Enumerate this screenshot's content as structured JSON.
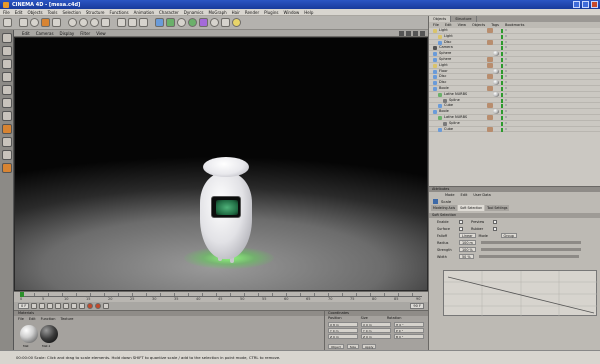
{
  "window": {
    "title": "CINEMA 4D - [mesa.c4d]"
  },
  "menu": [
    "File",
    "Edit",
    "Objects",
    "Tools",
    "Selection",
    "Structure",
    "Functions",
    "Animation",
    "Character",
    "Dynamics",
    "MoGraph",
    "Hair",
    "Render",
    "Plugins",
    "Window",
    "Help"
  ],
  "viewport": {
    "menu": [
      "Edit",
      "Cameras",
      "Display",
      "Filter",
      "View"
    ]
  },
  "timeline": {
    "ticks": [
      "0",
      "5",
      "10",
      "15",
      "20",
      "25",
      "30",
      "35",
      "40",
      "45",
      "50",
      "55",
      "60",
      "65",
      "70",
      "75",
      "80",
      "85",
      "90"
    ],
    "current_frame": "0 F",
    "end_frame": "90 F"
  },
  "materials": {
    "title": "Materials",
    "menu": [
      "File",
      "Edit",
      "Function",
      "Texture"
    ],
    "items": [
      "Mat",
      "Mat.1"
    ]
  },
  "coordinates": {
    "title": "Coordinates",
    "columns": [
      "Position",
      "Size",
      "Rotation"
    ],
    "rows": [
      [
        "X  8 m",
        "X  0 m",
        "H  0 °"
      ],
      [
        "Y  0 m",
        "Y  0 m",
        "P  0 °"
      ],
      [
        "Z  0 m",
        "Z  0 m",
        "B  0 °"
      ]
    ],
    "apply": [
      "Object",
      "Size",
      "Apply"
    ]
  },
  "object_manager": {
    "tabs": [
      "Objects",
      "Structure"
    ],
    "menu": [
      "File",
      "Edit",
      "View",
      "Objects",
      "Tags",
      "Bookmarks"
    ],
    "objects": [
      {
        "name": "Light",
        "color": "#d9c36a",
        "indent": 0,
        "tag": "checker"
      },
      {
        "name": "Light",
        "color": "#d9c36a",
        "indent": 1,
        "tag": ""
      },
      {
        "name": "Disc",
        "color": "#6a9bd9",
        "indent": 1,
        "tag": "checker"
      },
      {
        "name": "Camera",
        "color": "#555555",
        "indent": 0,
        "tag": ""
      },
      {
        "name": "Sphere",
        "color": "#6a9bd9",
        "indent": 0,
        "tag": "ball"
      },
      {
        "name": "Sphere",
        "color": "#6a9bd9",
        "indent": 0,
        "tag": "checker"
      },
      {
        "name": "Light",
        "color": "#d9c36a",
        "indent": 0,
        "tag": "checker"
      },
      {
        "name": "Floor",
        "color": "#6a9bd9",
        "indent": 0,
        "tag": "ball"
      },
      {
        "name": "Disc",
        "color": "#6a9bd9",
        "indent": 0,
        "tag": "checker"
      },
      {
        "name": "Disc",
        "color": "#6a9bd9",
        "indent": 0,
        "tag": "ball"
      },
      {
        "name": "Boole",
        "color": "#6a9bd9",
        "indent": 0,
        "tag": "checker"
      },
      {
        "name": "Lathe NURBS",
        "color": "#6ab06a",
        "indent": 1,
        "tag": "ball"
      },
      {
        "name": "Spline",
        "color": "#7a7a7a",
        "indent": 2,
        "tag": ""
      },
      {
        "name": "Cube",
        "color": "#6a9bd9",
        "indent": 1,
        "tag": "checker"
      },
      {
        "name": "Boole",
        "color": "#6a9bd9",
        "indent": 0,
        "tag": "ball"
      },
      {
        "name": "Lathe NURBS",
        "color": "#6ab06a",
        "indent": 1,
        "tag": "checker"
      },
      {
        "name": "Spline",
        "color": "#7a7a7a",
        "indent": 2,
        "tag": ""
      },
      {
        "name": "Cube",
        "color": "#6a9bd9",
        "indent": 1,
        "tag": "checker"
      }
    ]
  },
  "attribute_manager": {
    "title": "Attributes",
    "menu": [
      "Mode",
      "Edit",
      "User Data"
    ],
    "object_name": "Scale",
    "tabs": [
      "Modeling Axis",
      "Soft Selection",
      "Tool Settings"
    ],
    "section": "Soft Selection",
    "props": [
      {
        "label": "Enable",
        "value": "",
        "label2": "Preview",
        "value2": ""
      },
      {
        "label": "Surface",
        "value": "",
        "label2": "Rubber",
        "value2": ""
      },
      {
        "label": "Falloff",
        "value": "Linear",
        "label2": "Mode",
        "value2": "Group"
      },
      {
        "label": "Radius",
        "value": "100 m",
        "label2": "",
        "value2": ""
      },
      {
        "label": "Strength",
        "value": "100 %",
        "label2": "",
        "value2": ""
      },
      {
        "label": "Width",
        "value": "50 %",
        "label2": "",
        "value2": ""
      }
    ]
  },
  "status": "00:00:00   Scale: Click and drag to scale elements. Hold down SHIFT to quantize scale / add to the selection in point mode, CTRL to remove."
}
